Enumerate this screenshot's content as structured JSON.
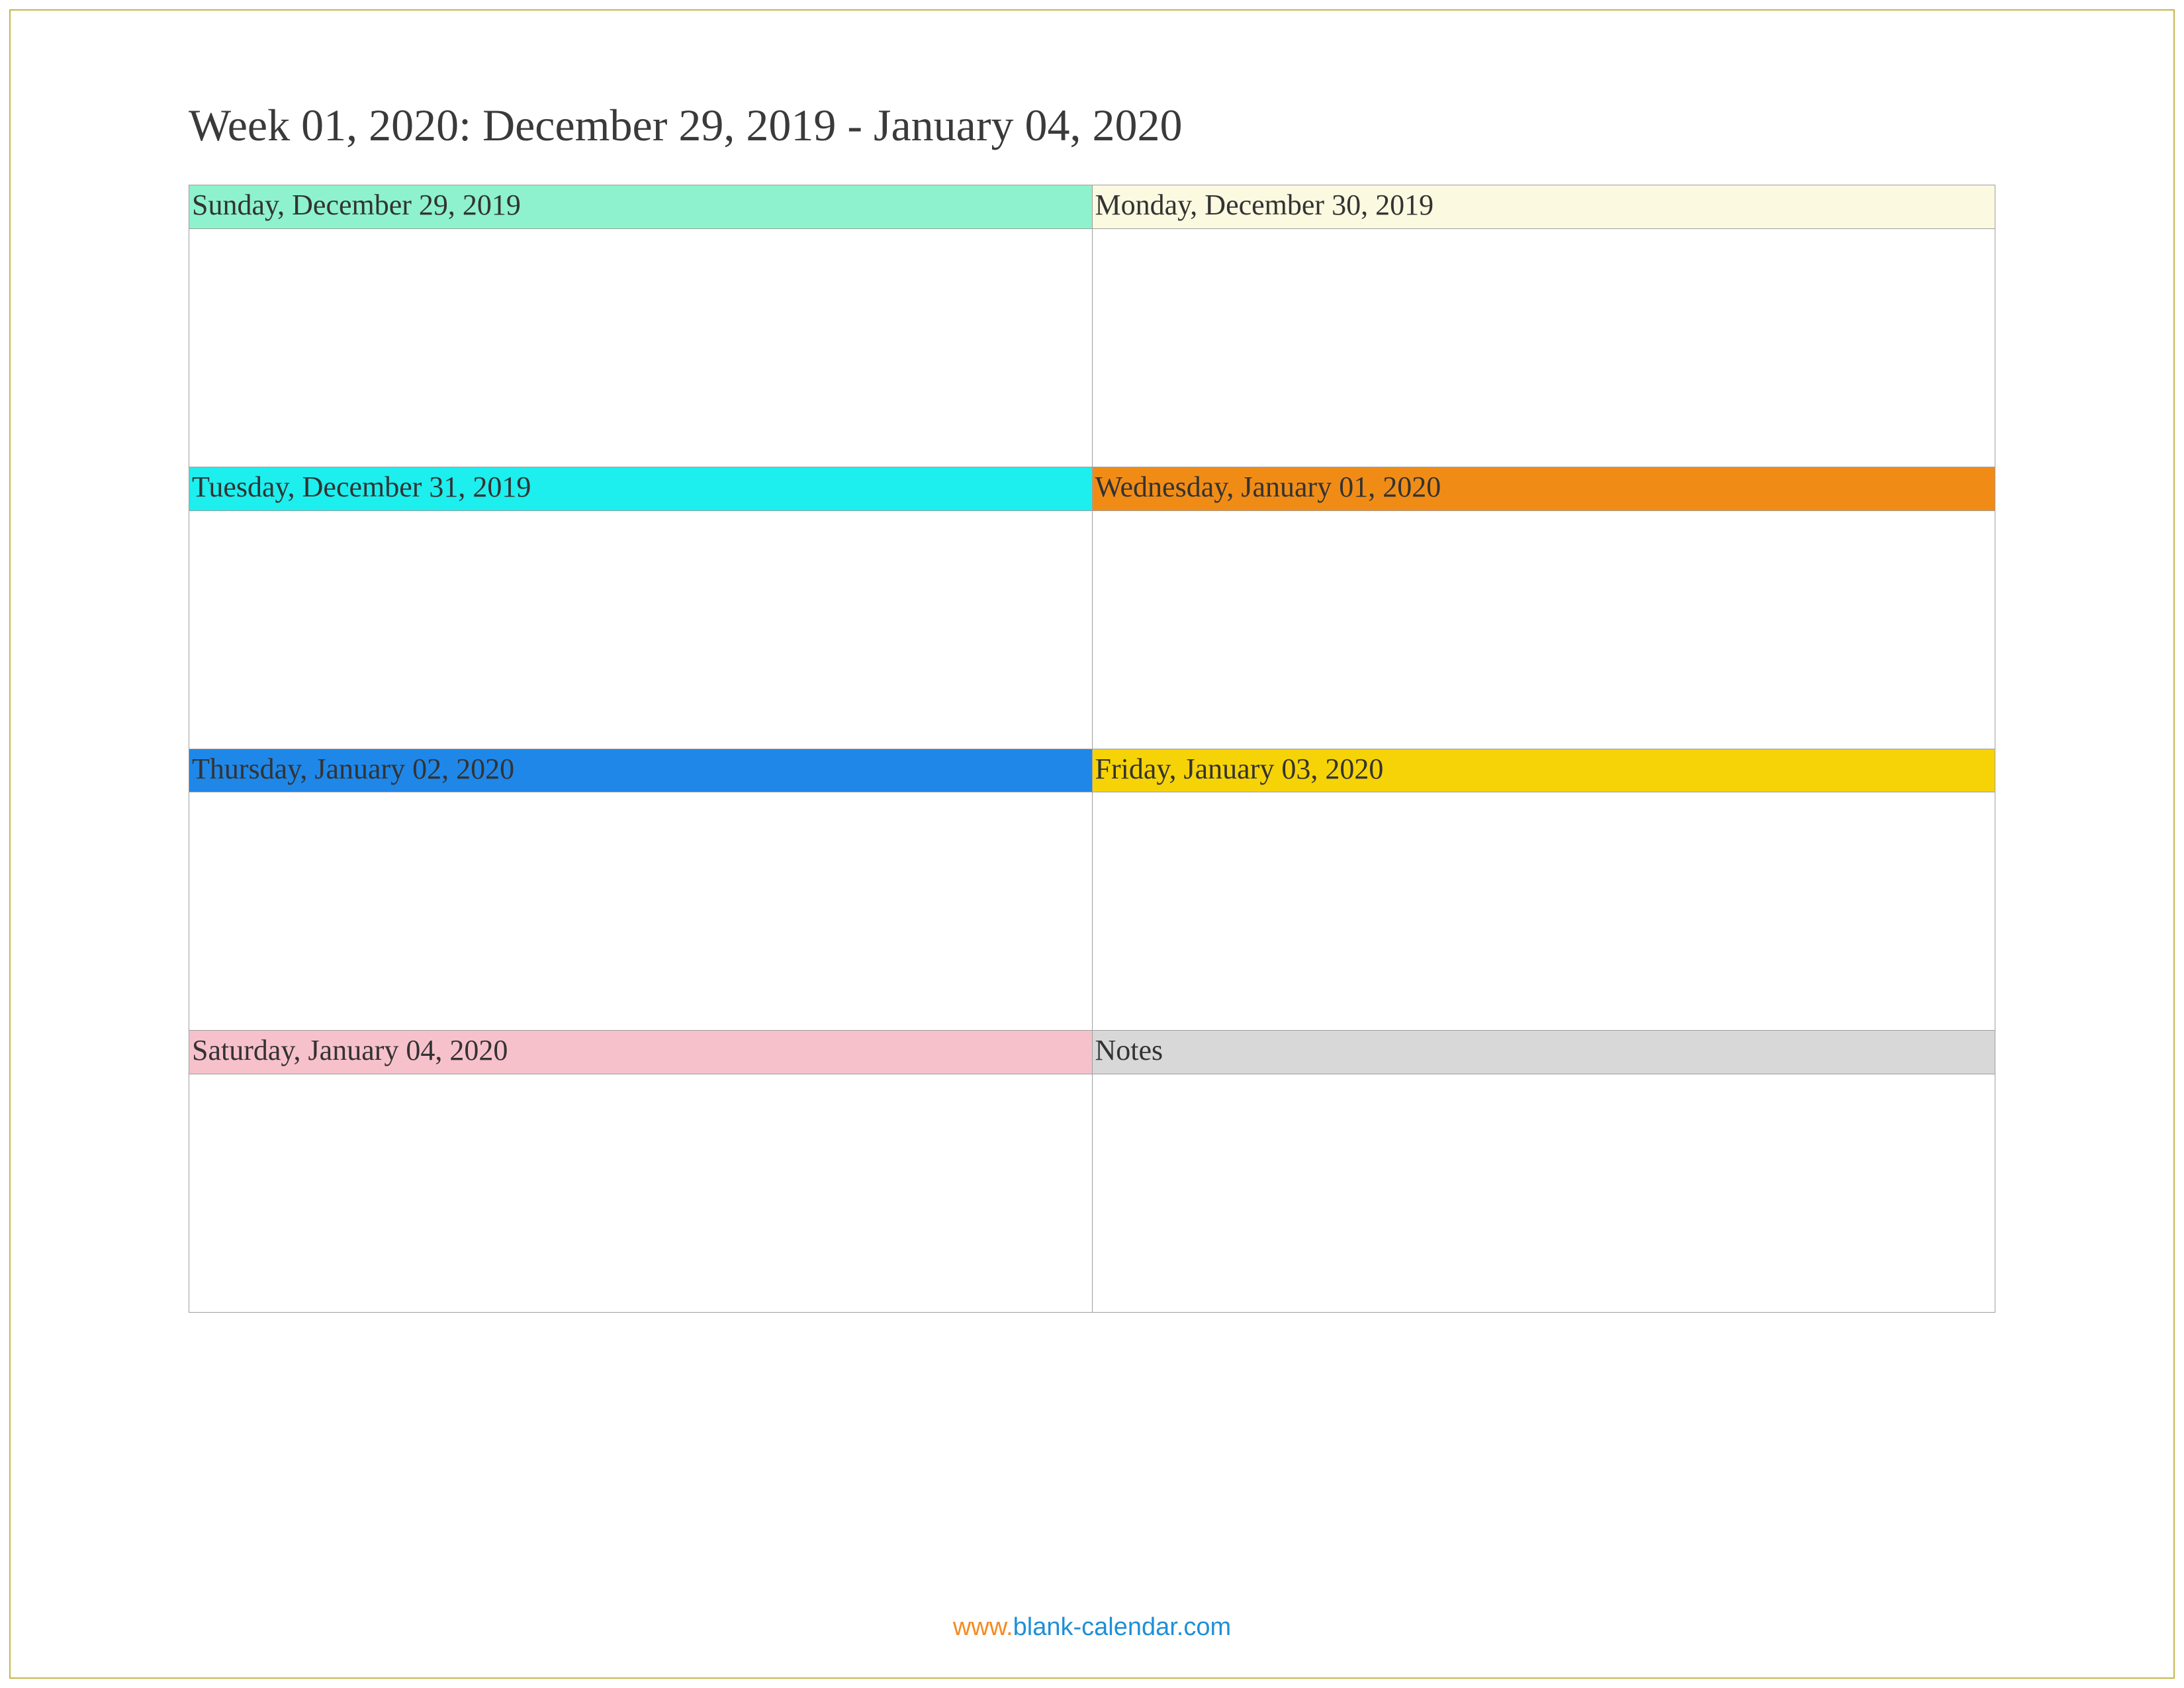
{
  "title": "Week 01, 2020: December 29, 2019 - January 04, 2020",
  "cells": [
    {
      "label": "Sunday, December 29, 2019",
      "bg": "#8df2cd"
    },
    {
      "label": "Monday, December 30, 2019",
      "bg": "#fbf9e0"
    },
    {
      "label": "Tuesday, December 31, 2019",
      "bg": "#1deeee"
    },
    {
      "label": "Wednesday, January 01, 2020",
      "bg": "#f08c16"
    },
    {
      "label": "Thursday, January 02, 2020",
      "bg": "#1f87e8"
    },
    {
      "label": "Friday, January 03, 2020",
      "bg": "#f6d307"
    },
    {
      "label": "Saturday, January 04, 2020",
      "bg": "#f7c1cc"
    },
    {
      "label": "Notes",
      "bg": "#d8d8d8"
    }
  ],
  "footer": {
    "www": "www.",
    "domain": "blank-calendar.com"
  }
}
